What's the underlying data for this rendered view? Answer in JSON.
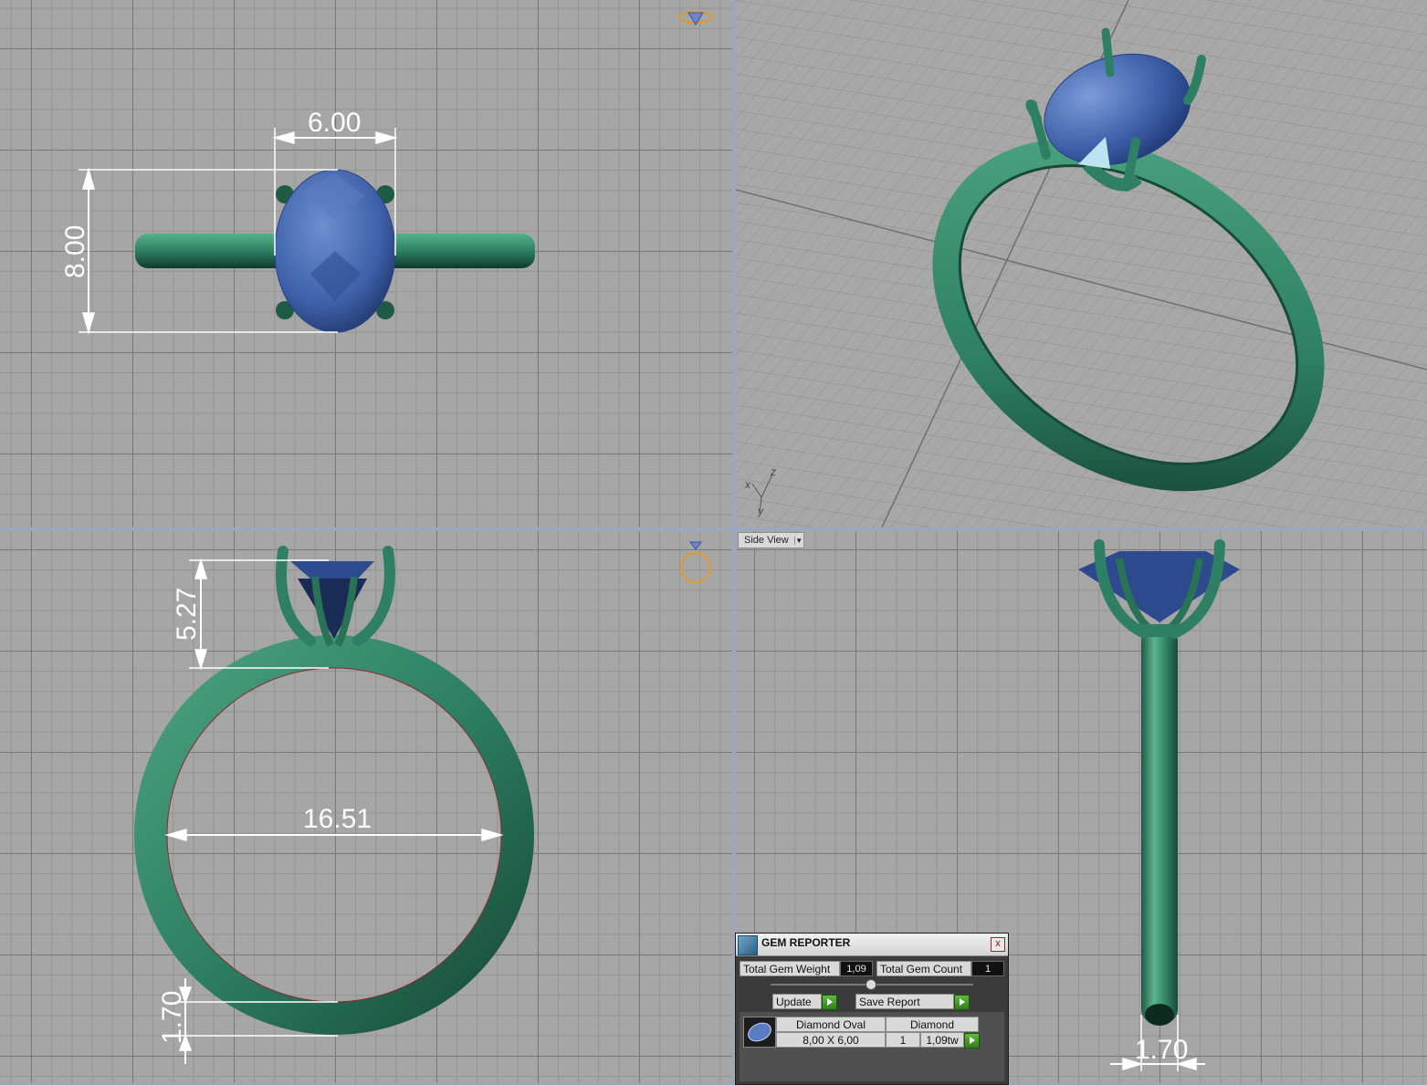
{
  "viewports": {
    "top": {
      "dimensions": {
        "width": "6.00",
        "length": "8.00"
      }
    },
    "front": {
      "dimensions": {
        "height": "5.27",
        "inner_diameter": "16.51",
        "band_thickness": "1.70"
      }
    },
    "perspective": {
      "axes": {
        "x": "x",
        "y": "y",
        "z": "z"
      }
    },
    "side": {
      "view_menu_label": "Side View",
      "dimensions": {
        "band_width": "1.70"
      }
    }
  },
  "gem_reporter": {
    "title": "GEM REPORTER",
    "close": "x",
    "total_gem_weight_label": "Total Gem Weight",
    "total_gem_weight_value": "1,09",
    "total_gem_count_label": "Total Gem Count",
    "total_gem_count_value": "1",
    "update_label": "Update",
    "save_report_label": "Save Report",
    "gem_row": {
      "shape": "Diamond Oval",
      "material": "Diamond",
      "size": "8,00 X 6,00",
      "count": "1",
      "weight": "1,09tw"
    }
  },
  "colors": {
    "metal": "#2e7f63",
    "gem": "#3d5fa8",
    "dimension_lines": "#ffffff",
    "viewport_bg": "#a6a6a6",
    "active_border": "#9aa7bd"
  }
}
